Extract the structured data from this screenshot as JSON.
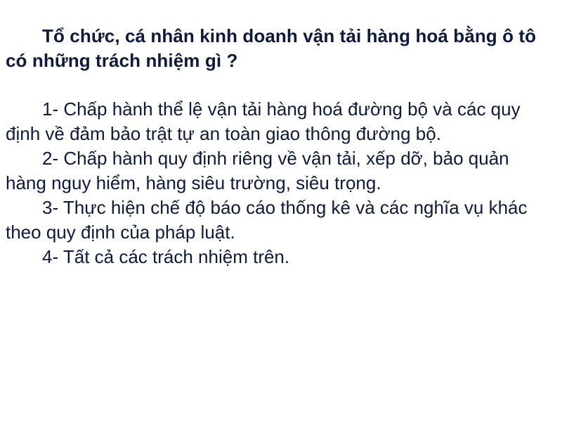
{
  "question": "Tổ chức, cá nhân kinh doanh vận tải hàng hoá bằng ô tô có những trách nhiệm gì ?",
  "answers": [
    "1- Chấp hành thể lệ vận tải hàng hoá đường bộ và các quy định về đảm bảo trật tự an toàn giao thông đường bộ.",
    "2- Chấp hành quy định riêng về vận tải, xếp dỡ, bảo quản hàng nguy hiểm, hàng siêu trường, siêu trọng.",
    "3- Thực hiện chế độ báo cáo thống kê và các nghĩa vụ khác theo quy định của pháp luật.",
    "4- Tất cả các trách nhiệm trên."
  ],
  "colors": {
    "text": "#0d1a3c",
    "background": "#ffffff"
  }
}
